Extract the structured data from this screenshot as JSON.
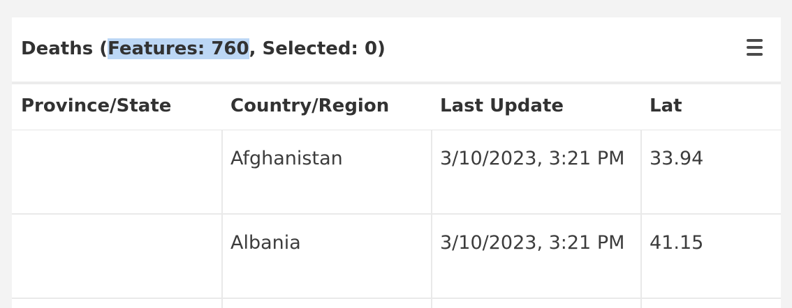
{
  "panel": {
    "title_prefix": "Deaths (",
    "title_highlighted": "Features: 760",
    "title_suffix": ", Selected: 0)",
    "menu_icon": "hamburger-menu-icon"
  },
  "table": {
    "columns": [
      "Province/State",
      "Country/Region",
      "Last Update",
      "Lat"
    ],
    "rows": [
      {
        "province_state": "",
        "country_region": "Afghanistan",
        "last_update": "3/10/2023, 3:21 PM",
        "lat": "33.94"
      },
      {
        "province_state": "",
        "country_region": "Albania",
        "last_update": "3/10/2023, 3:21 PM",
        "lat": "41.15"
      }
    ]
  },
  "colors": {
    "background": "#f3f3f3",
    "panel": "#ffffff",
    "text": "#323232",
    "selection_highlight": "#bcd7f5",
    "divider": "#e9e9e9"
  }
}
